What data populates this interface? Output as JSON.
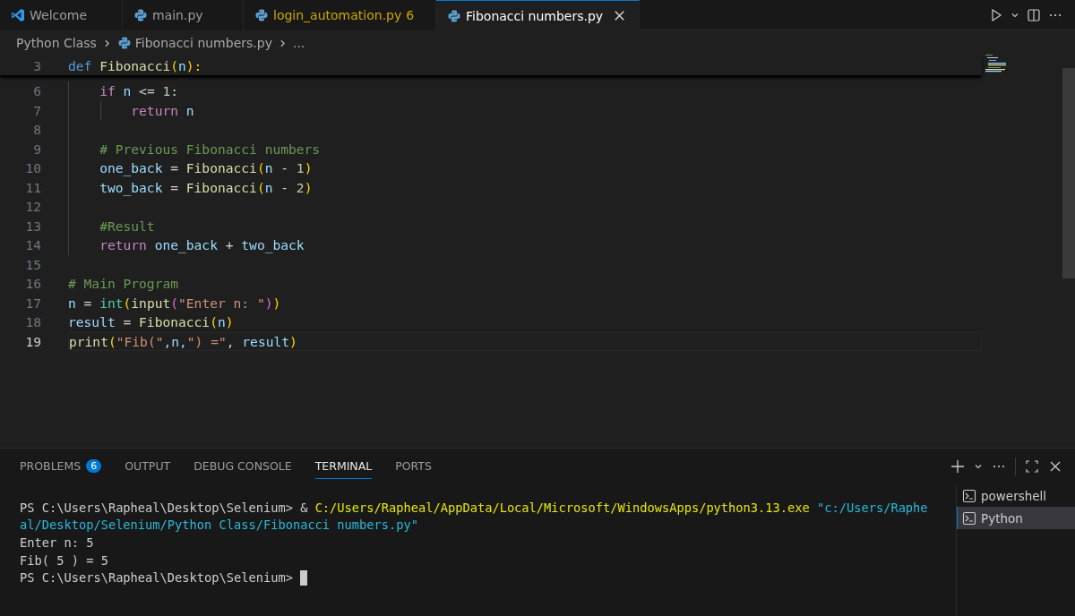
{
  "tabs": [
    {
      "label": "Welcome",
      "kind": "vscode",
      "selected": false,
      "warning": false
    },
    {
      "label": "main.py",
      "kind": "python",
      "selected": false,
      "warning": false
    },
    {
      "label": "login_automation.py",
      "kind": "python",
      "selected": false,
      "warning": true,
      "count": "6"
    },
    {
      "label": "Fibonacci numbers.py",
      "kind": "python",
      "selected": true,
      "warning": false
    }
  ],
  "breadcrumbs": [
    {
      "label": "Python Class",
      "kind": "folder"
    },
    {
      "label": "Fibonacci numbers.py",
      "kind": "python"
    },
    {
      "label": "...",
      "kind": "symbol"
    }
  ],
  "sticky_line": {
    "number": "3",
    "tokens": [
      {
        "t": "def ",
        "kind": "storage"
      },
      {
        "t": "Fibonacci",
        "kind": "fn"
      },
      {
        "t": "(",
        "kind": "paren"
      },
      {
        "t": "n",
        "kind": "var"
      },
      {
        "t": "):",
        "kind": "paren"
      }
    ]
  },
  "lines": [
    {
      "number": "6",
      "current": false,
      "tokens": [
        {
          "t": "    if ",
          "kind": "control"
        },
        {
          "t": "n",
          "kind": "var"
        },
        {
          "t": " <= ",
          "kind": "op"
        },
        {
          "t": "1",
          "kind": "num"
        },
        {
          "t": ":",
          "kind": "op"
        }
      ]
    },
    {
      "number": "7",
      "current": false,
      "tokens": [
        {
          "t": "        return ",
          "kind": "control"
        },
        {
          "t": "n",
          "kind": "var"
        }
      ]
    },
    {
      "number": "8",
      "current": false
    },
    {
      "number": "9",
      "current": false,
      "tokens": [
        {
          "t": "    # Previous Fibonacci numbers",
          "kind": "comment"
        }
      ]
    },
    {
      "number": "10",
      "current": false,
      "tokens": [
        {
          "t": "    one_back",
          "kind": "var"
        },
        {
          "t": " = ",
          "kind": "op"
        },
        {
          "t": "Fibonacci",
          "kind": "fn"
        },
        {
          "t": "(",
          "kind": "paren"
        },
        {
          "t": "n",
          "kind": "var"
        },
        {
          "t": " - ",
          "kind": "op"
        },
        {
          "t": "1",
          "kind": "num"
        },
        {
          "t": ")",
          "kind": "paren"
        }
      ]
    },
    {
      "number": "11",
      "current": false,
      "tokens": [
        {
          "t": "    two_back",
          "kind": "var"
        },
        {
          "t": " = ",
          "kind": "op"
        },
        {
          "t": "Fibonacci",
          "kind": "fn"
        },
        {
          "t": "(",
          "kind": "paren"
        },
        {
          "t": "n",
          "kind": "var"
        },
        {
          "t": " - ",
          "kind": "op"
        },
        {
          "t": "2",
          "kind": "num"
        },
        {
          "t": ")",
          "kind": "paren"
        }
      ]
    },
    {
      "number": "12",
      "current": false
    },
    {
      "number": "13",
      "current": false,
      "tokens": [
        {
          "t": "    #Result",
          "kind": "comment"
        }
      ]
    },
    {
      "number": "14",
      "current": false,
      "tokens": [
        {
          "t": "    return ",
          "kind": "control"
        },
        {
          "t": "one_back",
          "kind": "var"
        },
        {
          "t": " + ",
          "kind": "op"
        },
        {
          "t": "two_back",
          "kind": "var"
        }
      ]
    },
    {
      "number": "15",
      "current": false
    },
    {
      "number": "16",
      "current": false,
      "tokens": [
        {
          "t": "# Main Program",
          "kind": "comment"
        }
      ]
    },
    {
      "number": "17",
      "current": false,
      "tokens": [
        {
          "t": "n",
          "kind": "var"
        },
        {
          "t": " = ",
          "kind": "op"
        },
        {
          "t": "int",
          "kind": "type"
        },
        {
          "t": "(",
          "kind": "paren"
        },
        {
          "t": "input",
          "kind": "fn"
        },
        {
          "t": "(",
          "kind": "paren2"
        },
        {
          "t": "\"Enter n: \"",
          "kind": "str"
        },
        {
          "t": ")",
          "kind": "paren2"
        },
        {
          "t": ")",
          "kind": "paren"
        }
      ]
    },
    {
      "number": "18",
      "current": false,
      "tokens": [
        {
          "t": "result",
          "kind": "var"
        },
        {
          "t": " = ",
          "kind": "op"
        },
        {
          "t": "Fibonacci",
          "kind": "fn"
        },
        {
          "t": "(",
          "kind": "paren"
        },
        {
          "t": "n",
          "kind": "var"
        },
        {
          "t": ")",
          "kind": "paren"
        }
      ]
    },
    {
      "number": "19",
      "current": true,
      "tokens": [
        {
          "t": "print",
          "kind": "fn"
        },
        {
          "t": "(",
          "kind": "paren"
        },
        {
          "t": "\"Fib(\"",
          "kind": "str"
        },
        {
          "t": ",n,",
          "kind": "var"
        },
        {
          "t": "\") =\"",
          "kind": "str"
        },
        {
          "t": ", ",
          "kind": "op"
        },
        {
          "t": "result",
          "kind": "var"
        },
        {
          "t": ")",
          "kind": "paren"
        }
      ]
    }
  ],
  "panel_tabs": [
    {
      "label": "PROBLEMS",
      "selected": false,
      "count": "6"
    },
    {
      "label": "OUTPUT",
      "selected": false
    },
    {
      "label": "DEBUG CONSOLE",
      "selected": false
    },
    {
      "label": "TERMINAL",
      "selected": true
    },
    {
      "label": "PORTS",
      "selected": false
    }
  ],
  "terminal_lines": [
    {
      "kind": "text",
      "tokens": [
        {
          "t": "PS C:\\Users\\Rapheal\\Desktop\\Selenium> & ",
          "kind": "plain"
        },
        {
          "t": "C:/Users/Rapheal/AppData/Local/Microsoft/WindowsApps/python3.13.exe ",
          "kind": "command"
        },
        {
          "t": "\"c:/Users/Raphe",
          "kind": "string"
        }
      ]
    },
    {
      "kind": "text",
      "tokens": [
        {
          "t": "al/Desktop/Selenium/Python Class/Fibonacci numbers.py\"",
          "kind": "string"
        }
      ]
    },
    {
      "kind": "text",
      "tokens": [
        {
          "t": "Enter n: 5",
          "kind": "plain"
        }
      ]
    },
    {
      "kind": "text",
      "tokens": [
        {
          "t": "Fib( 5 ) = 5",
          "kind": "plain"
        }
      ]
    },
    {
      "kind": "prompt",
      "tokens": [
        {
          "t": "PS C:\\Users\\Rapheal\\Desktop\\Selenium> ",
          "kind": "plain"
        }
      ]
    }
  ],
  "terminals": [
    {
      "label": "powershell",
      "selected": false
    },
    {
      "label": "Python",
      "selected": true
    }
  ]
}
